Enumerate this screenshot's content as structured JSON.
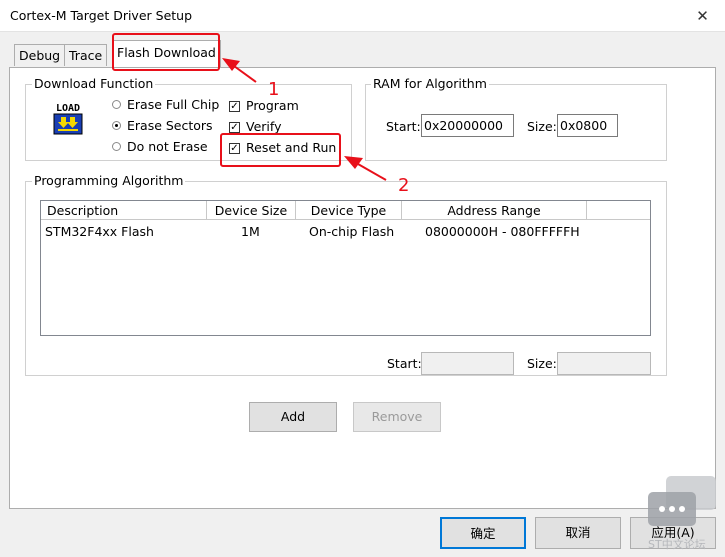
{
  "window": {
    "title": "Cortex-M Target Driver Setup",
    "close_glyph": "✕"
  },
  "tabs": [
    {
      "label": "Debug"
    },
    {
      "label": "Trace"
    },
    {
      "label": "Flash Download"
    }
  ],
  "download_function": {
    "legend": "Download Function",
    "icon_text": "LOAD",
    "erase_options": [
      {
        "label": "Erase Full Chip",
        "selected": false
      },
      {
        "label": "Erase Sectors",
        "selected": true
      },
      {
        "label": "Do not Erase",
        "selected": false
      }
    ],
    "checkboxes": [
      {
        "label": "Program",
        "checked": true
      },
      {
        "label": "Verify",
        "checked": true
      },
      {
        "label": "Reset and Run",
        "checked": true
      }
    ]
  },
  "ram": {
    "legend": "RAM for Algorithm",
    "start_label": "Start:",
    "start_value": "0x20000000",
    "size_label": "Size:",
    "size_value": "0x0800"
  },
  "programming_algorithm": {
    "legend": "Programming Algorithm",
    "columns": [
      "Description",
      "Device Size",
      "Device Type",
      "Address Range"
    ],
    "rows": [
      {
        "description": "STM32F4xx Flash",
        "device_size": "1M",
        "device_type": "On-chip Flash",
        "address_range": "08000000H - 080FFFFFH"
      }
    ],
    "start_label": "Start:",
    "start_value": "",
    "size_label": "Size:",
    "size_value": ""
  },
  "buttons": {
    "add": "Add",
    "remove": "Remove",
    "ok": "确定",
    "cancel": "取消",
    "apply": "应用(A)"
  },
  "annotations": {
    "num1": "1",
    "num2": "2"
  },
  "watermark": {
    "text": "ST中文论坛"
  },
  "colors": {
    "annotation": "#e8101a",
    "window_bg": "#f0f0f0",
    "accent": "#0078d7"
  }
}
